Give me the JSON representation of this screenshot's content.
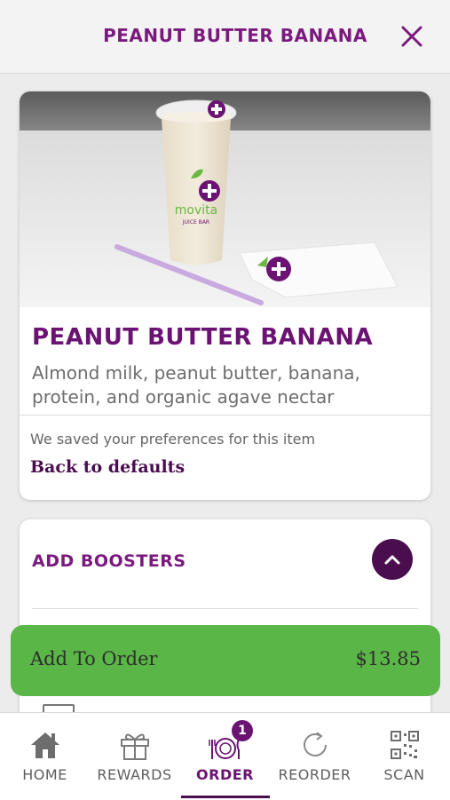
{
  "header": {
    "title": "PEANUT BUTTER BANANA"
  },
  "product": {
    "name": "PEANUT BUTTER BANANA",
    "description": "Almond milk, peanut butter, banana, protein, and organic agave nectar",
    "saved_note": "We saved your preferences for this item",
    "back_to_defaults": "Back to defaults",
    "cup_brand": "movita",
    "cup_subbrand": "JUICE BAR"
  },
  "boosters": {
    "title": "ADD BOOSTERS"
  },
  "add_to_order": {
    "label": "Add To Order",
    "price": "$13.85"
  },
  "tabbar": {
    "items": [
      {
        "label": "HOME",
        "icon": "home-icon"
      },
      {
        "label": "REWARDS",
        "icon": "gift-icon"
      },
      {
        "label": "ORDER",
        "icon": "order-plate-icon",
        "badge": "1",
        "active": true
      },
      {
        "label": "REORDER",
        "icon": "reorder-icon"
      },
      {
        "label": "SCAN",
        "icon": "qr-code-icon"
      }
    ]
  },
  "colors": {
    "brand_purple": "#6b1372",
    "dark_purple": "#4a0e4e",
    "add_green": "#5ab646"
  }
}
